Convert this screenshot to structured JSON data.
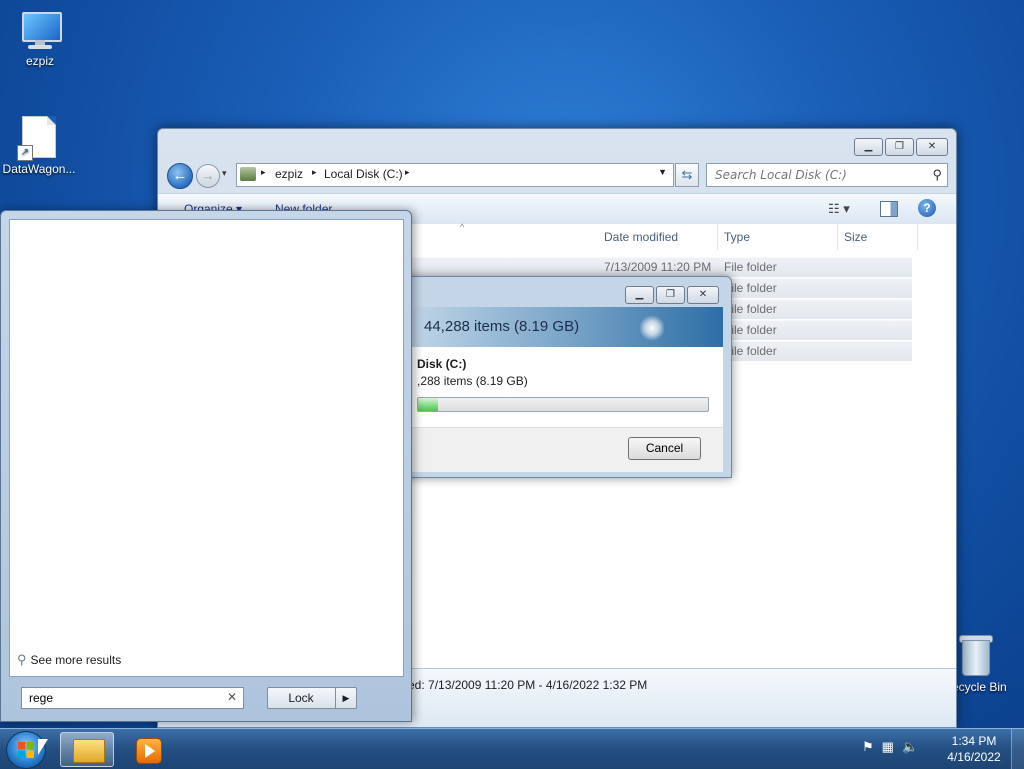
{
  "desktop": {
    "icons": [
      {
        "label": "ezpiz"
      },
      {
        "label": "DataWagon..."
      },
      {
        "label": "Recycle Bin"
      }
    ]
  },
  "explorer": {
    "breadcrumb": [
      "ezpiz",
      "Local Disk (C:)"
    ],
    "search_placeholder": "Search Local Disk (C:)",
    "toolbar": {
      "organize": "Organize ▾",
      "new_folder": "New folder"
    },
    "columns": [
      "Date modified",
      "Type",
      "Size"
    ],
    "rows": [
      {
        "date": "7/13/2009 11:20 PM",
        "type": "File folder"
      },
      {
        "date": "",
        "type": "File folder"
      },
      {
        "date": "",
        "type": "File folder"
      },
      {
        "date": "",
        "type": "File folder"
      },
      {
        "date": "",
        "type": "File folder"
      }
    ],
    "details": "ed: 7/13/2009 11:20 PM - 4/16/2022 1:32 PM"
  },
  "copy_dialog": {
    "banner": "44,288 items (8.19 GB)",
    "source": "Disk (C:)",
    "count": ",288 items (8.19 GB)",
    "progress": 0.07,
    "cancel": "Cancel"
  },
  "start_menu": {
    "see_more": "See more results",
    "search_value": "rege",
    "lock_label": "Lock"
  },
  "taskbar": {
    "time": "1:34 PM",
    "date": "4/16/2022"
  }
}
